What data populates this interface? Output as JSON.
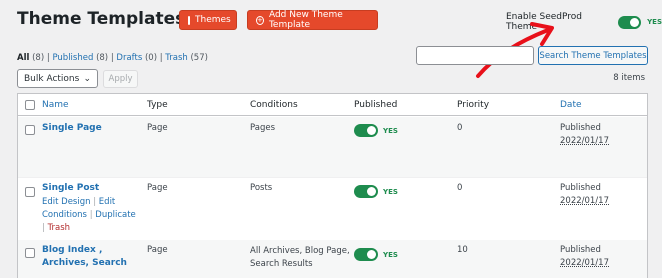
{
  "header": {
    "title": "Theme Templates",
    "help_glyph": "?",
    "themes_label": "Themes",
    "add_label": "Add New Theme Template",
    "enable_label": "Enable SeedProd Theme",
    "enable_state": "YES"
  },
  "filters": {
    "all": "All",
    "all_count": "(8)",
    "published": "Published",
    "published_count": "(8)",
    "drafts": "Drafts",
    "drafts_count": "(0)",
    "trash": "Trash",
    "trash_count": "(57)",
    "sep": "|"
  },
  "bulk": {
    "selected": "Bulk Actions",
    "apply_label": "Apply"
  },
  "search": {
    "button_label": "Search Theme Templates"
  },
  "items_count": "8 items",
  "columns": {
    "name": "Name",
    "type": "Type",
    "conditions": "Conditions",
    "published": "Published",
    "priority": "Priority",
    "date": "Date"
  },
  "rows": [
    {
      "name": "Single Page",
      "type": "Page",
      "conditions": "Pages",
      "published": "YES",
      "priority": "0",
      "date_status": "Published",
      "date": "2022/01/17"
    },
    {
      "name": "Single Post",
      "type": "Page",
      "conditions": "Posts",
      "published": "YES",
      "priority": "0",
      "date_status": "Published",
      "date": "2022/01/17",
      "actions": {
        "edit_design": "Edit Design",
        "edit_conditions_1": "Edit",
        "edit_conditions_2": "Conditions",
        "duplicate": "Duplicate",
        "trash": "Trash",
        "sep": "|"
      }
    },
    {
      "name_line1": "Blog Index ,",
      "name_line2": "Archives, Search",
      "type": "Page",
      "conditions_line1": "All Archives, Blog Page,",
      "conditions_line2": "Search Results",
      "published": "YES",
      "priority": "10",
      "date_status": "Published",
      "date": "2022/01/17"
    }
  ],
  "colors": {
    "accent_orange": "#e5492b",
    "toggle_green": "#1e8c4e",
    "link_blue": "#2271b1",
    "arrow_red": "#e8101a"
  }
}
